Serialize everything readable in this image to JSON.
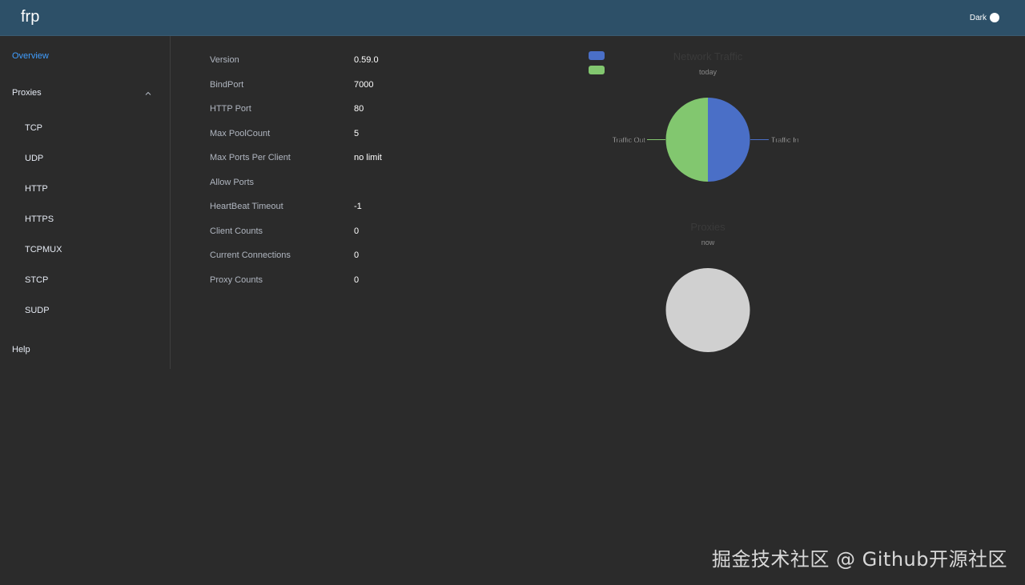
{
  "app": {
    "brand": "frp",
    "theme_label": "Dark"
  },
  "sidebar": {
    "overview": "Overview",
    "proxies": "Proxies",
    "proxy_types": [
      "TCP",
      "UDP",
      "HTTP",
      "HTTPS",
      "TCPMUX",
      "STCP",
      "SUDP"
    ],
    "help": "Help",
    "active_color": "#409eff"
  },
  "server_info": [
    {
      "label": "Version",
      "value": "0.59.0"
    },
    {
      "label": "BindPort",
      "value": "7000"
    },
    {
      "label": "HTTP Port",
      "value": "80"
    },
    {
      "label": "Max PoolCount",
      "value": "5"
    },
    {
      "label": "Max Ports Per Client",
      "value": "no limit"
    },
    {
      "label": "Allow Ports",
      "value": ""
    },
    {
      "label": "HeartBeat Timeout",
      "value": "-1"
    },
    {
      "label": "Client Counts",
      "value": "0"
    },
    {
      "label": "Current Connections",
      "value": "0"
    },
    {
      "label": "Proxy Counts",
      "value": "0"
    }
  ],
  "chart_data": [
    {
      "type": "pie",
      "title": "Network Traffic",
      "subtitle": "today",
      "legend": "top-left",
      "categories": [
        "Traffic In",
        "Traffic Out"
      ],
      "values": [
        50,
        50
      ],
      "colors": [
        "#4a6fc7",
        "#82c76f"
      ]
    },
    {
      "type": "pie",
      "title": "Proxies",
      "subtitle": "now",
      "categories": [],
      "values": [],
      "empty_color": "#d0d0d0"
    }
  ],
  "watermark": "掘金技术社区 @ Github开源社区"
}
